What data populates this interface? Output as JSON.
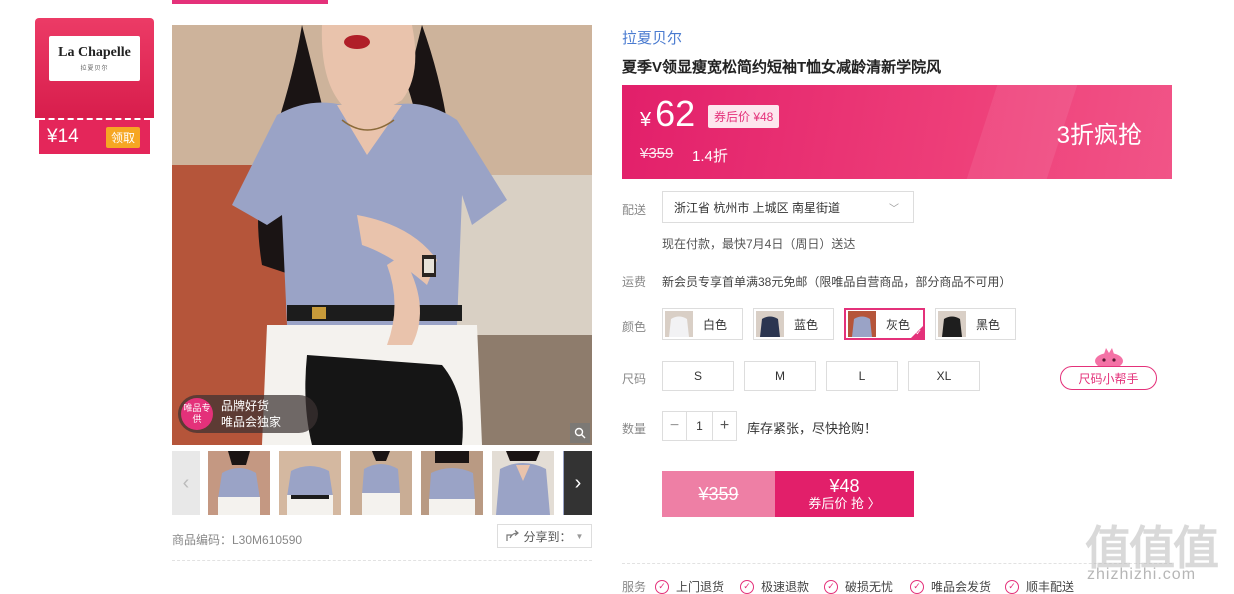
{
  "brand_card": {
    "logo_name": "La Chapelle",
    "logo_sub": "拉夏贝尔",
    "coupon_amount": "¥14",
    "claim_label": "领取"
  },
  "gallery": {
    "promo_circle": "唯品专供",
    "promo_line1": "品牌好货",
    "promo_line2": "唯品会独家",
    "thumb_count": 6
  },
  "product_code": "商品编码：L30M610590",
  "share_label": "分享到：",
  "product": {
    "brand": "拉夏贝尔",
    "title": "夏季V领显瘦宽松简约短袖T恤女减龄清新学院风"
  },
  "price": {
    "currency": "¥",
    "current": "62",
    "coupon_tag": "券后价 ¥48",
    "original": "¥359",
    "discount": "1.4折",
    "flash_text": "3折疯抢"
  },
  "delivery": {
    "label": "配送",
    "location": "浙江省 杭州市 上城区 南星街道",
    "note": "现在付款，最快7月4日（周日）送达"
  },
  "shipping": {
    "label": "运费",
    "note": "新会员专享首单满38元免邮（限唯品自营商品，部分商品不可用）"
  },
  "colors": {
    "label": "颜色",
    "options": [
      {
        "name": "白色",
        "swatch": "#f2f2f4",
        "selected": false
      },
      {
        "name": "蓝色",
        "swatch": "#2b3550",
        "selected": false
      },
      {
        "name": "灰色",
        "swatch": "#9aa3c6",
        "selected": true
      },
      {
        "name": "黑色",
        "swatch": "#1e1e1e",
        "selected": false
      }
    ]
  },
  "sizes": {
    "label": "尺码",
    "options": [
      "S",
      "M",
      "L",
      "XL"
    ],
    "helper": "尺码小帮手"
  },
  "quantity": {
    "label": "数量",
    "value": "1",
    "minus": "−",
    "plus": "+",
    "stock_note": "库存紧张，尽快抢购！"
  },
  "buy": {
    "original": "¥359",
    "coupon_price": "¥48",
    "coupon_text": "券后价 抢 〉"
  },
  "services": {
    "label": "服务",
    "items": [
      "上门退货",
      "极速退款",
      "破损无忧",
      "唯品会发货",
      "顺丰配送"
    ]
  },
  "watermark": {
    "glyphs": "值值值",
    "url": "zhizhizhi.com"
  },
  "colors_theme": {
    "accent": "#e4317a",
    "brand_link": "#4a7bd0"
  }
}
